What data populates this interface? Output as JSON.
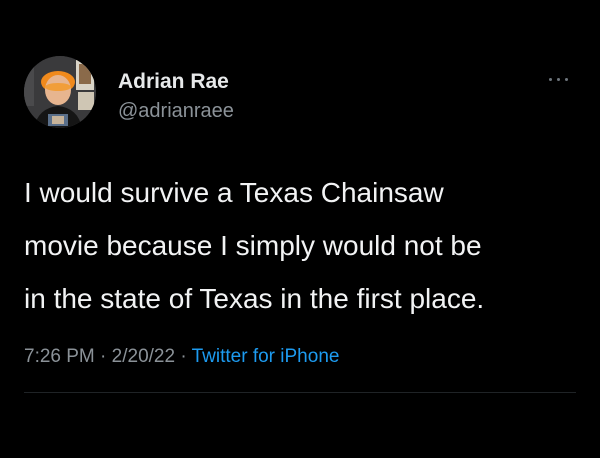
{
  "author": {
    "name": "Adrian Rae",
    "handle": "@adrianraee",
    "avatar_icon": "profile-photo"
  },
  "tweet": {
    "lines": [
      "I would survive a Texas Chainsaw",
      "movie because I simply would not be",
      "in the state of Texas in the first place."
    ]
  },
  "meta": {
    "time": "7:26 PM",
    "separator": "·",
    "date": "2/20/22",
    "source": "Twitter for iPhone"
  },
  "colors": {
    "background": "#000000",
    "text": "#e7e9ea",
    "secondary": "#8b9298",
    "link": "#1d9bf0"
  },
  "icons": {
    "more": "more-dots-icon"
  }
}
